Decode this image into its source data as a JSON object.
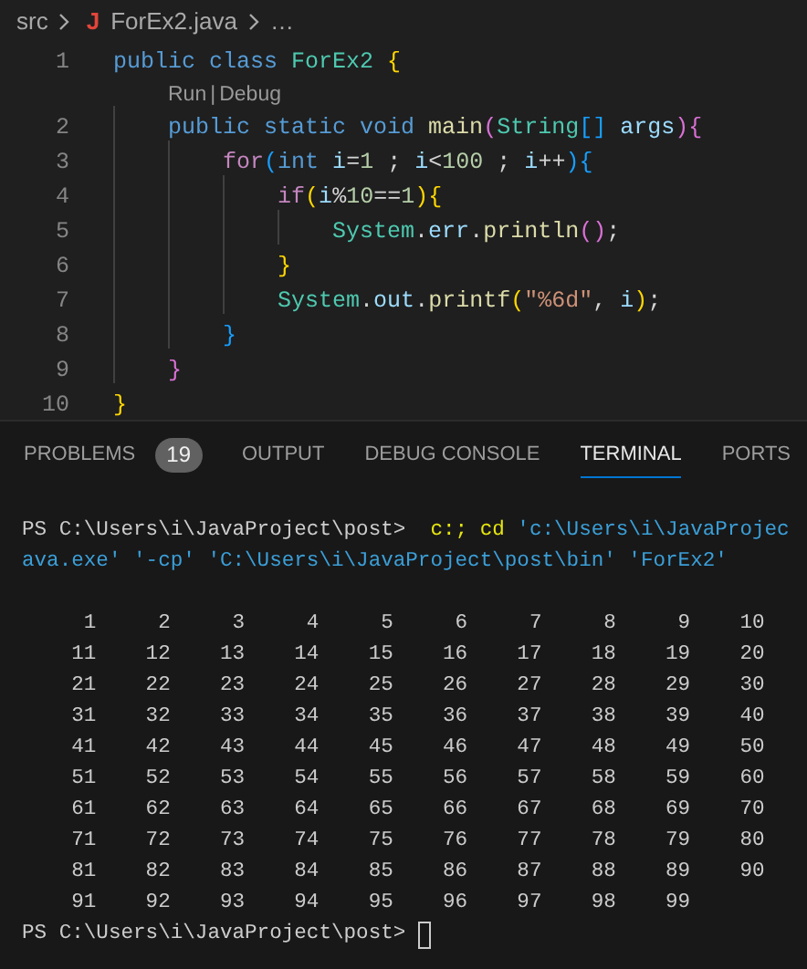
{
  "breadcrumb": [
    {
      "text": "src"
    },
    {
      "text": "ForEx2.java",
      "icon": "J"
    },
    {
      "text": "…"
    }
  ],
  "editor": {
    "lines": [
      {
        "kind": "code",
        "number": "1",
        "tokens": [
          {
            "text": "public",
            "kind": "keyword"
          },
          {
            "text": " class",
            "kind": "keyword"
          },
          {
            "text": " ForEx2",
            "kind": "type"
          },
          {
            "text": " {",
            "kind": "brace1"
          }
        ]
      },
      {
        "kind": "codelens",
        "links": [
          "Run",
          "Debug"
        ],
        "separator": "|"
      },
      {
        "kind": "code",
        "number": "2",
        "tokens": [
          {
            "text": "    public",
            "kind": "keyword"
          },
          {
            "text": " static",
            "kind": "keyword"
          },
          {
            "text": " void",
            "kind": "keyword"
          },
          {
            "text": " main",
            "kind": "function"
          },
          {
            "text": "(",
            "kind": "brace2"
          },
          {
            "text": "String",
            "kind": "type"
          },
          {
            "text": "[]",
            "kind": "brace3"
          },
          {
            "text": " args",
            "kind": "variable"
          },
          {
            "text": ")",
            "kind": "brace2"
          },
          {
            "text": "{",
            "kind": "brace2"
          }
        ]
      },
      {
        "kind": "code",
        "number": "3",
        "tokens": [
          {
            "text": "        for",
            "kind": "control"
          },
          {
            "text": "(",
            "kind": "brace3"
          },
          {
            "text": "int",
            "kind": "keyword"
          },
          {
            "text": " i",
            "kind": "variable"
          },
          {
            "text": "=",
            "kind": "operator"
          },
          {
            "text": "1",
            "kind": "number"
          },
          {
            "text": " ;"
          },
          {
            "text": " i",
            "kind": "variable"
          },
          {
            "text": "<",
            "kind": "operator"
          },
          {
            "text": "100",
            "kind": "number"
          },
          {
            "text": " ;"
          },
          {
            "text": " i",
            "kind": "variable"
          },
          {
            "text": "++",
            "kind": "operator"
          },
          {
            "text": ")",
            "kind": "brace3"
          },
          {
            "text": "{",
            "kind": "brace3"
          }
        ]
      },
      {
        "kind": "code",
        "number": "4",
        "tokens": [
          {
            "text": "            if",
            "kind": "control"
          },
          {
            "text": "(",
            "kind": "brace1"
          },
          {
            "text": "i",
            "kind": "variable"
          },
          {
            "text": "%",
            "kind": "operator"
          },
          {
            "text": "10",
            "kind": "number"
          },
          {
            "text": "==",
            "kind": "operator"
          },
          {
            "text": "1",
            "kind": "number"
          },
          {
            "text": ")",
            "kind": "brace1"
          },
          {
            "text": "{",
            "kind": "brace1"
          }
        ]
      },
      {
        "kind": "code",
        "number": "5",
        "tokens": [
          {
            "text": "                System",
            "kind": "type"
          },
          {
            "text": "."
          },
          {
            "text": "err",
            "kind": "variable"
          },
          {
            "text": "."
          },
          {
            "text": "println",
            "kind": "function"
          },
          {
            "text": "()",
            "kind": "brace2"
          },
          {
            "text": ";"
          }
        ]
      },
      {
        "kind": "code",
        "number": "6",
        "tokens": [
          {
            "text": "            }",
            "kind": "brace1"
          }
        ]
      },
      {
        "kind": "code",
        "number": "7",
        "tokens": [
          {
            "text": "            System",
            "kind": "type"
          },
          {
            "text": "."
          },
          {
            "text": "out",
            "kind": "variable"
          },
          {
            "text": "."
          },
          {
            "text": "printf",
            "kind": "function"
          },
          {
            "text": "(",
            "kind": "brace1"
          },
          {
            "text": "\"%6d\"",
            "kind": "string"
          },
          {
            "text": ","
          },
          {
            "text": " i",
            "kind": "variable"
          },
          {
            "text": ")",
            "kind": "brace1"
          },
          {
            "text": ";"
          }
        ]
      },
      {
        "kind": "code",
        "number": "8",
        "tokens": [
          {
            "text": "        }",
            "kind": "brace3"
          }
        ]
      },
      {
        "kind": "code",
        "number": "9",
        "tokens": [
          {
            "text": "    }",
            "kind": "brace2"
          }
        ]
      },
      {
        "kind": "code",
        "number": "10",
        "tokens": [
          {
            "text": "}",
            "kind": "brace1"
          }
        ]
      }
    ]
  },
  "panel": {
    "tabs": [
      {
        "label": "PROBLEMS",
        "badge": "19",
        "selected": false
      },
      {
        "label": "OUTPUT",
        "selected": false
      },
      {
        "label": "DEBUG CONSOLE",
        "selected": false
      },
      {
        "label": "TERMINAL",
        "selected": true
      },
      {
        "label": "PORTS",
        "selected": false
      }
    ]
  },
  "terminal": {
    "lines": [
      [
        {
          "text": "PS C:\\Users\\i\\JavaProject\\post>",
          "kind": "output"
        },
        {
          "text": "  c:; cd",
          "kind": "command"
        },
        {
          "text": " 'c:\\Users\\i\\JavaProjec",
          "kind": "string"
        }
      ],
      [
        {
          "text": "ava.exe' '-cp' 'C:\\Users\\i\\JavaProject\\post\\bin' 'ForEx2'",
          "kind": "string"
        }
      ],
      [
        {
          "text": "     1     2     3     4     5     6     7     8     9    10",
          "kind": "output"
        }
      ],
      [
        {
          "text": "    11    12    13    14    15    16    17    18    19    20",
          "kind": "output"
        }
      ],
      [
        {
          "text": "    21    22    23    24    25    26    27    28    29    30",
          "kind": "output"
        }
      ],
      [
        {
          "text": "    31    32    33    34    35    36    37    38    39    40",
          "kind": "output"
        }
      ],
      [
        {
          "text": "    41    42    43    44    45    46    47    48    49    50",
          "kind": "output"
        }
      ],
      [
        {
          "text": "    51    52    53    54    55    56    57    58    59    60",
          "kind": "output"
        }
      ],
      [
        {
          "text": "    61    62    63    64    65    66    67    68    69    70",
          "kind": "output"
        }
      ],
      [
        {
          "text": "    71    72    73    74    75    76    77    78    79    80",
          "kind": "output"
        }
      ],
      [
        {
          "text": "    81    82    83    84    85    86    87    88    89    90",
          "kind": "output"
        }
      ],
      [
        {
          "text": "    91    92    93    94    95    96    97    98    99",
          "kind": "output"
        }
      ]
    ],
    "prompt": {
      "text": "PS C:\\Users\\i\\JavaProject\\post>",
      "cursor": true
    }
  }
}
